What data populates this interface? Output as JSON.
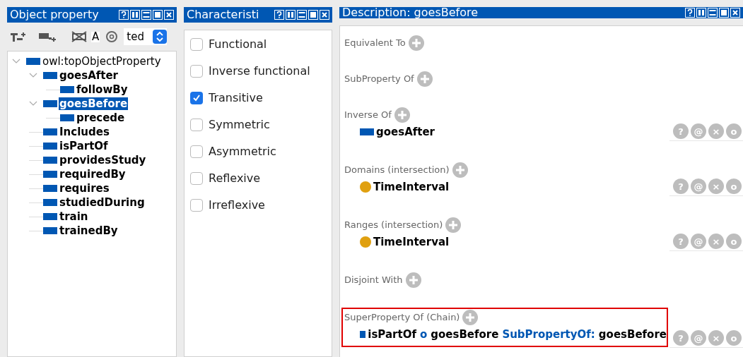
{
  "object_property_panel": {
    "title": "Object property",
    "toolbar_texts": [
      "A",
      "ted"
    ],
    "tree": [
      {
        "label": "owl:topObjectProperty",
        "selected": false,
        "expanded": true,
        "children": [
          {
            "label": "goesAfter",
            "selected": false,
            "expanded": true,
            "children": [
              {
                "label": "followBy",
                "selected": false
              }
            ]
          },
          {
            "label": "goesBefore",
            "selected": true,
            "expanded": true,
            "children": [
              {
                "label": "precede",
                "selected": false
              }
            ]
          },
          {
            "label": "Includes",
            "selected": false
          },
          {
            "label": "isPartOf",
            "selected": false
          },
          {
            "label": "providesStudy",
            "selected": false
          },
          {
            "label": "requiredBy",
            "selected": false
          },
          {
            "label": "requires",
            "selected": false
          },
          {
            "label": "studiedDuring",
            "selected": false
          },
          {
            "label": "train",
            "selected": false
          },
          {
            "label": "trainedBy",
            "selected": false
          }
        ]
      }
    ]
  },
  "characteristics_panel": {
    "title": "Characteristi",
    "items": [
      {
        "label": "Functional",
        "checked": false
      },
      {
        "label": "Inverse functional",
        "checked": false
      },
      {
        "label": "Transitive",
        "checked": true
      },
      {
        "label": "Symmetric",
        "checked": false
      },
      {
        "label": "Asymmetric",
        "checked": false
      },
      {
        "label": "Reflexive",
        "checked": false
      },
      {
        "label": "Irreflexive",
        "checked": false
      }
    ]
  },
  "description_panel": {
    "title": "Description: goesBefore",
    "sections": [
      {
        "label": "Equivalent To",
        "highlighted": false
      },
      {
        "label": "SubProperty Of",
        "highlighted": false
      },
      {
        "label": "Inverse Of",
        "highlighted": false,
        "entries": [
          {
            "kind": "property",
            "segments": [
              {
                "text": "goesAfter",
                "keyword": false
              }
            ],
            "actions": [
              "?",
              "@",
              "×",
              "o"
            ]
          }
        ]
      },
      {
        "label": "Domains (intersection)",
        "highlighted": false,
        "entries": [
          {
            "kind": "class",
            "segments": [
              {
                "text": "TimeInterval",
                "keyword": false
              }
            ],
            "actions": [
              "?",
              "@",
              "×",
              "o"
            ]
          }
        ]
      },
      {
        "label": "Ranges (intersection)",
        "highlighted": false,
        "entries": [
          {
            "kind": "class",
            "segments": [
              {
                "text": "TimeInterval",
                "keyword": false
              }
            ],
            "actions": [
              "?",
              "@",
              "×",
              "o"
            ]
          }
        ]
      },
      {
        "label": "Disjoint With",
        "highlighted": false
      },
      {
        "label": "SuperProperty Of (Chain)",
        "highlighted": true,
        "entries": [
          {
            "kind": "property",
            "segments": [
              {
                "text": "isPartOf",
                "keyword": false
              },
              {
                "text": "o",
                "keyword": true
              },
              {
                "text": "goesBefore",
                "keyword": false
              },
              {
                "text": "SubPropertyOf:",
                "keyword": true
              },
              {
                "text": "goesBefore",
                "keyword": false
              }
            ],
            "actions": [
              "?",
              "@",
              "×",
              "o"
            ]
          }
        ]
      }
    ]
  }
}
